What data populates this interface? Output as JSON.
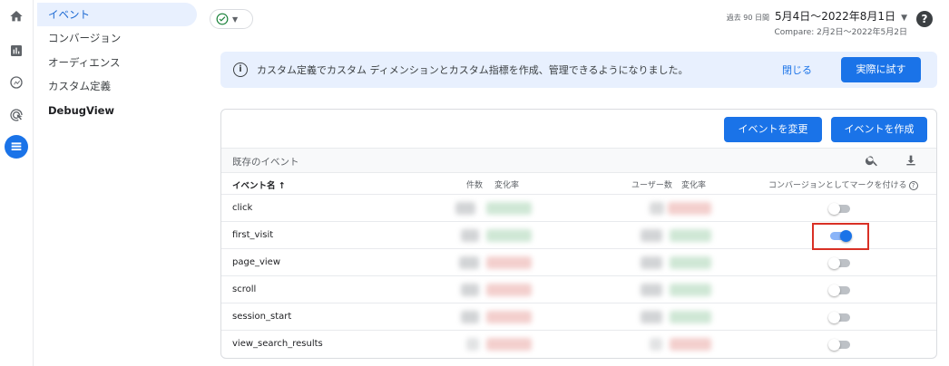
{
  "sidebar": {
    "items": [
      {
        "label": "イベント",
        "active": true
      },
      {
        "label": "コンバージョン"
      },
      {
        "label": "オーディエンス"
      },
      {
        "label": "カスタム定義"
      },
      {
        "label": "DebugView",
        "bold": true
      }
    ]
  },
  "header": {
    "date_prefix": "過去 90 日間",
    "date_range": "5月4日～2022年8月1日",
    "compare": "Compare: 2月2日～2022年5月2日",
    "help": "?"
  },
  "banner": {
    "text": "カスタム定義でカスタム ディメンションとカスタム指標を作成、管理できるようになりました。",
    "close_label": "閉じる",
    "try_label": "実際に試す"
  },
  "card": {
    "modify_label": "イベントを変更",
    "create_label": "イベントを作成",
    "existing_title": "既存のイベント",
    "headers": {
      "name": "イベント名 ↑",
      "count": "件数",
      "count_change": "変化率",
      "users": "ユーザー数",
      "users_change": "変化率",
      "conversion": "コンバージョンとしてマークを付ける"
    },
    "rows": [
      {
        "name": "click",
        "conversion": false
      },
      {
        "name": "first_visit",
        "conversion": true
      },
      {
        "name": "page_view",
        "conversion": false
      },
      {
        "name": "scroll",
        "conversion": false
      },
      {
        "name": "session_start",
        "conversion": false
      },
      {
        "name": "view_search_results",
        "conversion": false
      }
    ]
  },
  "colors": {
    "accent": "#1a73e8",
    "banner_bg": "#e8f0fe",
    "highlight": "#d93025"
  }
}
